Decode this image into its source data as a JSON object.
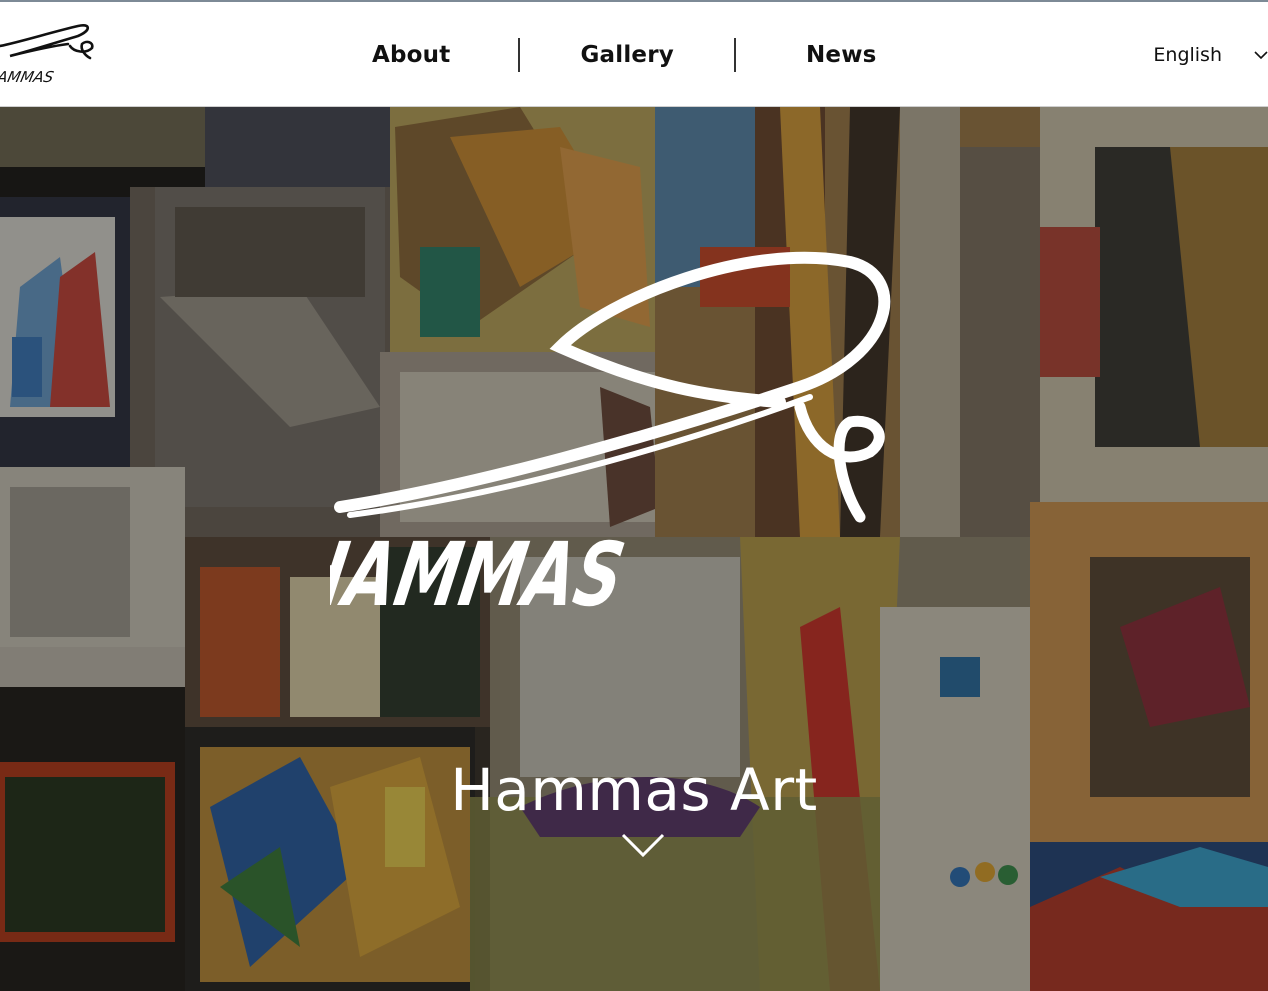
{
  "brand": {
    "wordmark": "HAMMAS"
  },
  "nav": {
    "items": [
      {
        "label": "About"
      },
      {
        "label": "Gallery"
      },
      {
        "label": "News"
      }
    ]
  },
  "language": {
    "selected": "English"
  },
  "hero": {
    "title": "Hammas Art",
    "signature_text": "HAMMAS"
  },
  "icons": {
    "language": "chevron-down-icon",
    "scroll": "chevron-down-icon"
  },
  "colors": {
    "header_bg": "#ffffff",
    "text_dark": "#111111",
    "hero_text": "#ffffff"
  }
}
